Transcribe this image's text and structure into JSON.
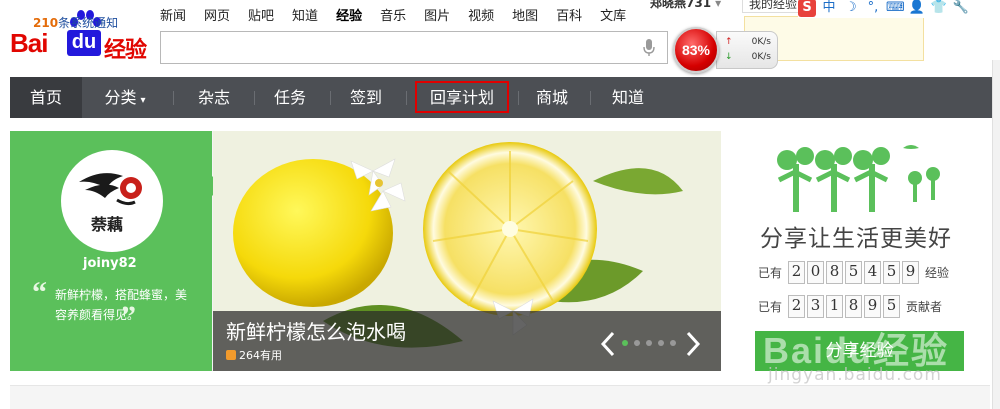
{
  "brand": {
    "logo_bai": "Bai",
    "logo_du": "du",
    "logo_sub": "经验"
  },
  "topnav": [
    "新闻",
    "网页",
    "贴吧",
    "知道",
    "经验",
    "音乐",
    "图片",
    "视频",
    "地图",
    "百科",
    "文库"
  ],
  "topnav_active": "经验",
  "user": {
    "name": "郑晓燕731",
    "my_experience": "我的经验"
  },
  "search": {
    "value": "",
    "placeholder": ""
  },
  "speed_widget": {
    "percent": "83%",
    "up": "0K/s",
    "down": "0K/s"
  },
  "notification": {
    "count": "210",
    "text": "条系统通知"
  },
  "navbar": {
    "items": [
      "首页",
      "分类",
      "杂志",
      "任务",
      "签到",
      "回享计划",
      "商城",
      "知道"
    ],
    "active": "首页"
  },
  "profile": {
    "username": "joiny82",
    "motto": "新鲜柠檬，搭配蜂蜜，美容养颜看得见。"
  },
  "slide": {
    "title": "新鲜柠檬怎么泡水喝",
    "useful_count": "264",
    "useful_label": "有用"
  },
  "right_panel": {
    "slogan": "分享让生活更美好",
    "stat1": {
      "prefix": "已有",
      "digits": [
        "2",
        "0",
        "8",
        "5",
        "4",
        "5",
        "9"
      ],
      "suffix": "经验"
    },
    "stat2": {
      "prefix": "已有",
      "digits": [
        "2",
        "3",
        "1",
        "8",
        "9",
        "5"
      ],
      "suffix": "贡献者"
    },
    "share_button": "分享经验"
  },
  "watermark": {
    "logo": "Baidu经验",
    "url": "jingyan.baidu.com"
  },
  "colors": {
    "brand_red": "#e10601",
    "brand_blue": "#2319dc",
    "nav_bg": "#4c4f54",
    "green": "#5bc05b",
    "highlight": "#e10000"
  }
}
